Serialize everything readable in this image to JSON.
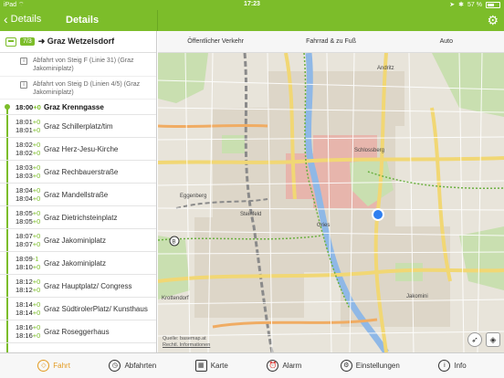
{
  "status_bar": {
    "device": "iPad",
    "wifi_icon": "wifi-icon",
    "time": "17:23",
    "bluetooth": "✱",
    "battery_text": "57 %",
    "battery_level": 0.57
  },
  "nav": {
    "back_label": "Details",
    "title": "Details",
    "settings_icon": "gear-icon"
  },
  "route": {
    "line": "7/3",
    "destination": "➜ Graz Wetzelsdorf",
    "infos": [
      "Abfahrt von Steig F (Linie 31) (Graz Jakominiplatz)",
      "Abfahrt von Steig D (Linien 4/5) (Graz Jakominiplatz)"
    ]
  },
  "stops": [
    {
      "time": "18:00",
      "delay": "+0",
      "name": "Graz Krenngasse"
    },
    {
      "time1": "18:01",
      "delay1": "+0",
      "time2": "18:01",
      "delay2": "+0",
      "name": "Graz Schillerplatz/tim"
    },
    {
      "time1": "18:02",
      "delay1": "+0",
      "time2": "18:02",
      "delay2": "+0",
      "name": "Graz Herz-Jesu-Kirche"
    },
    {
      "time1": "18:03",
      "delay1": "+0",
      "time2": "18:03",
      "delay2": "+0",
      "name": "Graz Rechbauerstraße"
    },
    {
      "time1": "18:04",
      "delay1": "+0",
      "time2": "18:04",
      "delay2": "+0",
      "name": "Graz Mandellstraße"
    },
    {
      "time1": "18:05",
      "delay1": "+0",
      "time2": "18:05",
      "delay2": "+0",
      "name": "Graz Dietrichsteinplatz"
    },
    {
      "time1": "18:07",
      "delay1": "+0",
      "time2": "18:07",
      "delay2": "+0",
      "name": "Graz Jakominiplatz"
    },
    {
      "time1": "18:09",
      "delay1": "-1",
      "time2": "18:10",
      "delay2": "+0",
      "name": "Graz Jakominiplatz"
    },
    {
      "time1": "18:12",
      "delay1": "+0",
      "time2": "18:12",
      "delay2": "+0",
      "name": "Graz Hauptplatz/ Congress"
    },
    {
      "time1": "18:14",
      "delay1": "+0",
      "time2": "18:14",
      "delay2": "+0",
      "name": "Graz SüdtirolerPlatz/ Kunsthaus"
    },
    {
      "time1": "18:16",
      "delay1": "+0",
      "time2": "18:16",
      "delay2": "+0",
      "name": "Graz Roseggerhaus"
    }
  ],
  "segments": [
    "Öffentlicher Verkehr",
    "Fahrrad & zu Fuß",
    "Auto"
  ],
  "map": {
    "labels": [
      "Eggenberg",
      "Gries",
      "Jakomini",
      "Krottendorf",
      "Andritz",
      "Steinfeld",
      "Schlossberg"
    ],
    "credit_line1": "Quelle: basemap.at",
    "credit_line2": "Rechtl. Informationen"
  },
  "tabs": [
    {
      "label": "Fahrt",
      "icon": "compass-icon",
      "active": true
    },
    {
      "label": "Abfahrten",
      "icon": "clock-icon",
      "active": false
    },
    {
      "label": "Karte",
      "icon": "map-icon",
      "active": false
    },
    {
      "label": "Alarm",
      "icon": "alarm-icon",
      "active": false
    },
    {
      "label": "Einstellungen",
      "icon": "gear-icon",
      "active": false
    },
    {
      "label": "Info",
      "icon": "info-icon",
      "active": false
    }
  ],
  "colors": {
    "brand_green": "#7cbd2a",
    "active_tab": "#e39b22",
    "location_dot": "#2f7ff0"
  }
}
